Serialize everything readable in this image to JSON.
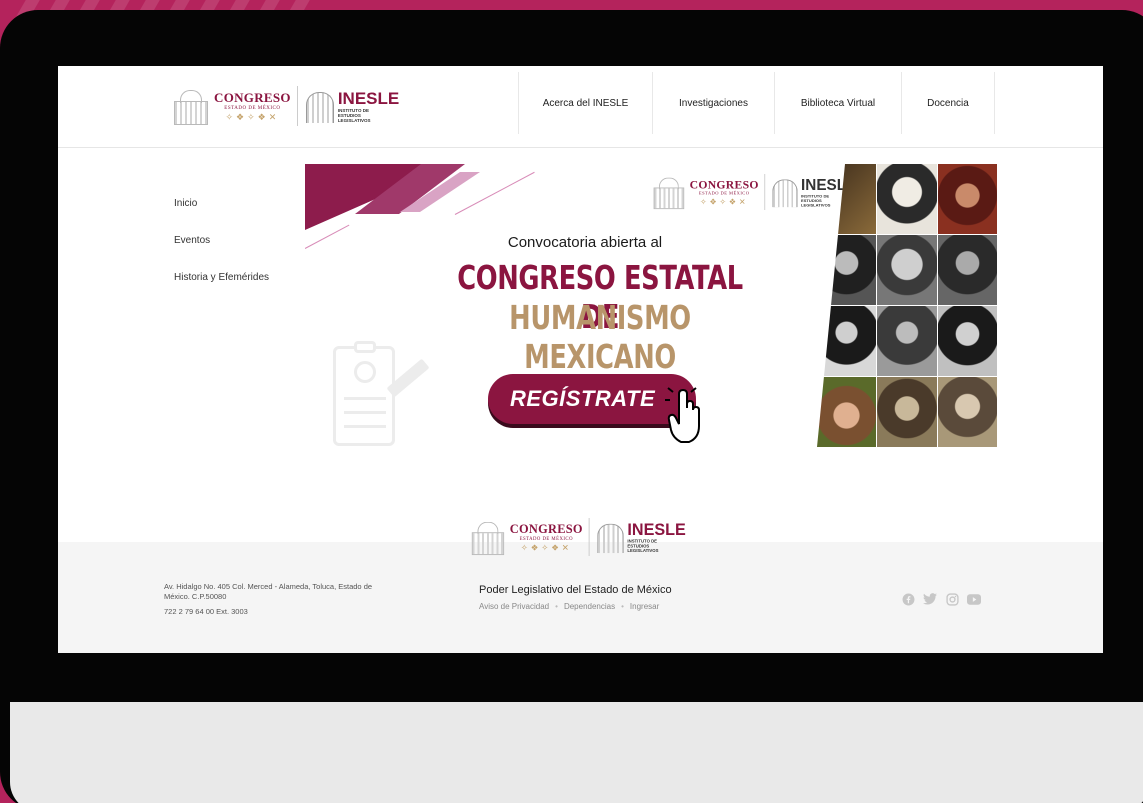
{
  "header": {
    "logo": {
      "congreso": "CONGRESO",
      "congreso_sub": "ESTADO DE MÉXICO",
      "congreso_symbols": "✧❖✧❖✕",
      "inesle": "INESLE",
      "inesle_sub": "INSTITUTO DE ESTUDIOS LEGISLATIVOS"
    },
    "nav": [
      {
        "label": "Acerca del INESLE"
      },
      {
        "label": "Investigaciones"
      },
      {
        "label": "Biblioteca Virtual"
      },
      {
        "label": "Docencia"
      }
    ]
  },
  "sidebar": {
    "items": [
      {
        "label": "Inicio"
      },
      {
        "label": "Eventos"
      },
      {
        "label": "Historia y Efemérides"
      }
    ]
  },
  "banner": {
    "intro": "Convocatoria abierta al",
    "title_line1": "CONGRESO ESTATAL DE",
    "title_line2": "HUMANISMO MEXICANO",
    "button": "REGÍSTRATE"
  },
  "footer": {
    "address": "Av. Hidalgo No. 405 Col. Merced - Alameda, Toluca, Estado de México. C.P.50080",
    "phone": "722 2 79 64 00 Ext. 3003",
    "org": "Poder Legislativo del Estado de México",
    "links": [
      {
        "label": "Aviso de Privacidad"
      },
      {
        "label": "Dependencias"
      },
      {
        "label": "Ingresar"
      }
    ],
    "social": [
      "facebook-icon",
      "twitter-icon",
      "instagram-icon",
      "youtube-icon"
    ]
  },
  "colors": {
    "brand": "#8b1540",
    "gold": "#b8956a",
    "background": "#b4235c"
  }
}
